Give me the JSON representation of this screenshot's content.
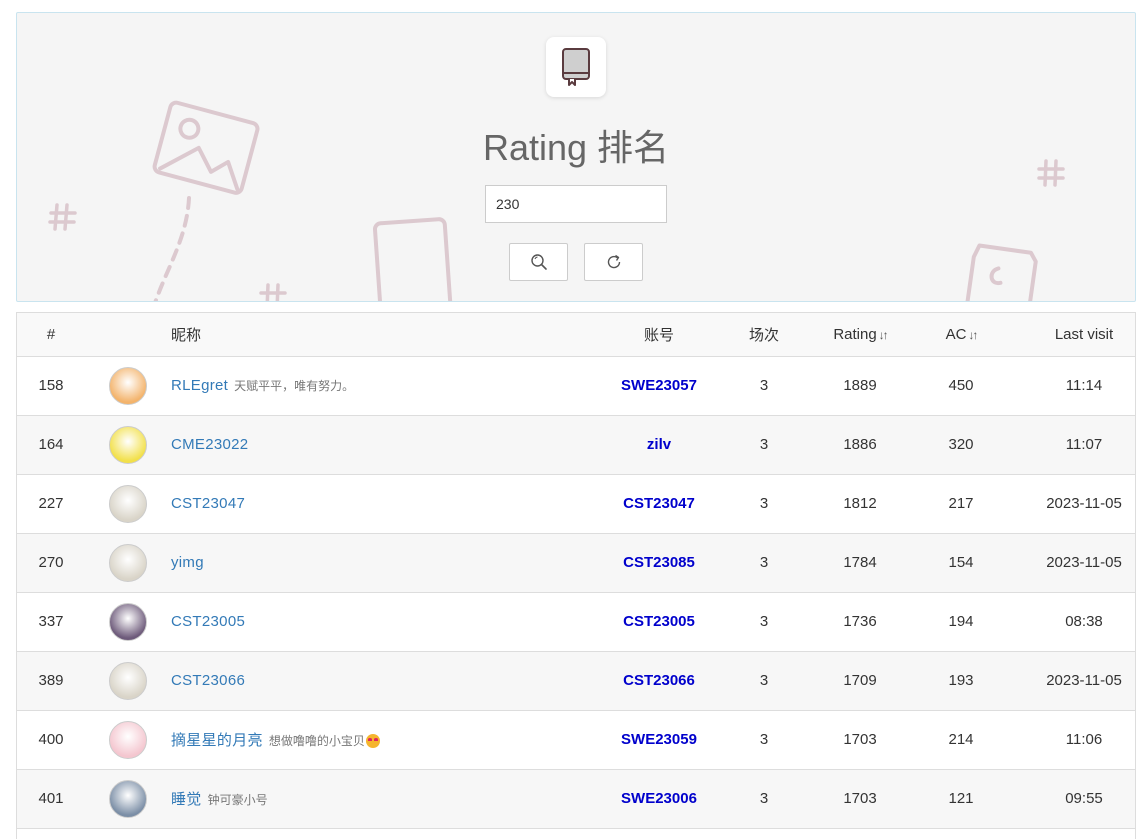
{
  "hero": {
    "title": "Rating 排名",
    "search_value": "230",
    "logo_icon": "book-icon",
    "search_button_icon": "search-icon",
    "reset_button_icon": "refresh-icon"
  },
  "table": {
    "headers": {
      "rank": "#",
      "avatar": "",
      "nickname": "昵称",
      "account": "账号",
      "contests": "场次",
      "rating": "Rating",
      "ac": "AC",
      "last_visit": "Last visit"
    },
    "sort_icon": "sort-arrows-icon",
    "rows": [
      {
        "rank": "158",
        "avatar_color": "#f3b36b",
        "nickname": "RLEgret",
        "motto": "天赋平平，唯有努力。",
        "account": "SWE23057",
        "contests": "3",
        "rating": "1889",
        "ac": "450",
        "last_visit": "11:14"
      },
      {
        "rank": "164",
        "avatar_color": "#f2e04a",
        "nickname": "CME23022",
        "motto": "",
        "account": "zilv",
        "contests": "3",
        "rating": "1886",
        "ac": "320",
        "last_visit": "11:07"
      },
      {
        "rank": "227",
        "avatar_color": "#d9d4c8",
        "nickname": "CST23047",
        "motto": "",
        "account": "CST23047",
        "contests": "3",
        "rating": "1812",
        "ac": "217",
        "last_visit": "2023-11-05"
      },
      {
        "rank": "270",
        "avatar_color": "#d9d4c8",
        "nickname": "yimg",
        "motto": "",
        "account": "CST23085",
        "contests": "3",
        "rating": "1784",
        "ac": "154",
        "last_visit": "2023-11-05"
      },
      {
        "rank": "337",
        "avatar_color": "#6d5a7a",
        "nickname": "CST23005",
        "motto": "",
        "account": "CST23005",
        "contests": "3",
        "rating": "1736",
        "ac": "194",
        "last_visit": "08:38"
      },
      {
        "rank": "389",
        "avatar_color": "#d9d4c8",
        "nickname": "CST23066",
        "motto": "",
        "account": "CST23066",
        "contests": "3",
        "rating": "1709",
        "ac": "193",
        "last_visit": "2023-11-05"
      },
      {
        "rank": "400",
        "avatar_color": "#f4c6cf",
        "nickname": "摘星星的月亮",
        "motto": "想做噜噜的小宝贝",
        "motto_emoji": "heart-eyes-emoji",
        "account": "SWE23059",
        "contests": "3",
        "rating": "1703",
        "ac": "214",
        "last_visit": "11:06"
      },
      {
        "rank": "401",
        "avatar_color": "#7b8ea6",
        "nickname": "睡觉",
        "motto": "钟可豪小号",
        "account": "SWE23006",
        "contests": "3",
        "rating": "1703",
        "ac": "121",
        "last_visit": "09:55"
      }
    ]
  }
}
